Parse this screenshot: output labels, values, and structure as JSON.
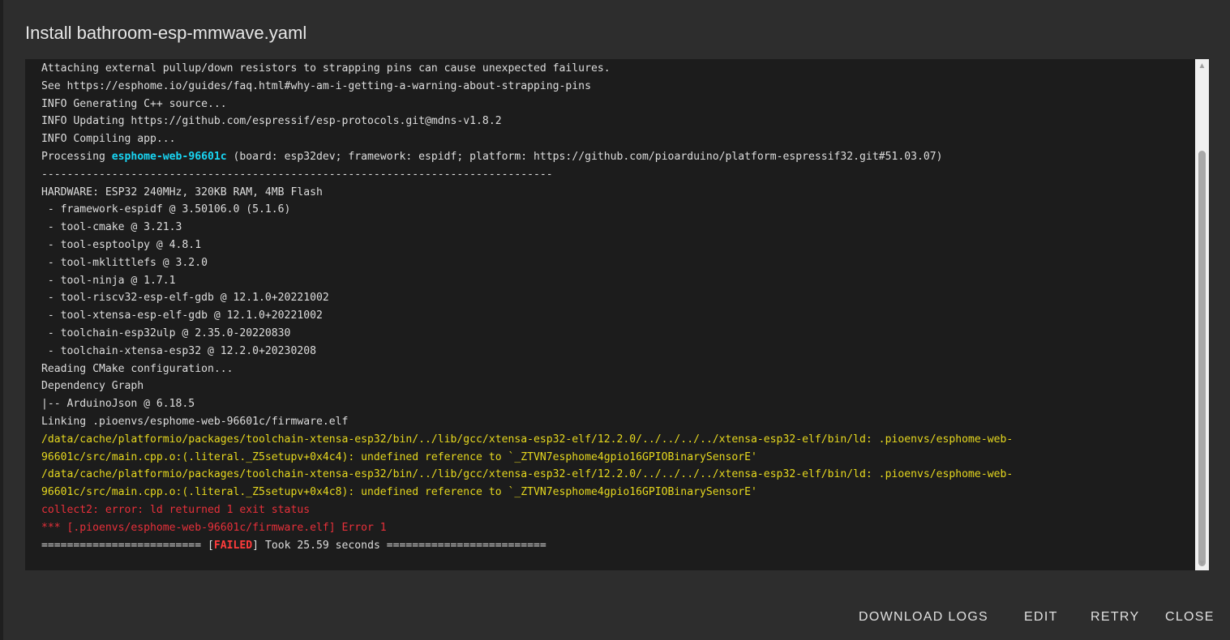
{
  "dialog": {
    "title": "Install bathroom-esp-mmwave.yaml"
  },
  "log": {
    "lines": [
      [
        {
          "t": "Attaching external pullup/down resistors to strapping pins can cause unexpected failures."
        }
      ],
      [
        {
          "t": "See https://esphome.io/guides/faq.html#why-am-i-getting-a-warning-about-strapping-pins"
        }
      ],
      [
        {
          "t": "INFO Generating C++ source..."
        }
      ],
      [
        {
          "t": "INFO Updating https://github.com/espressif/esp-protocols.git@mdns-v1.8.2"
        }
      ],
      [
        {
          "t": "INFO Compiling app..."
        }
      ],
      [
        {
          "t": "Processing "
        },
        {
          "t": "esphome-web-96601c",
          "c": "cyan"
        },
        {
          "t": " (board: esp32dev; framework: espidf; platform: https://github.com/pioarduino/platform-espressif32.git#51.03.07)"
        }
      ],
      [
        {
          "t": "--------------------------------------------------------------------------------"
        }
      ],
      [
        {
          "t": "HARDWARE: ESP32 240MHz, 320KB RAM, 4MB Flash"
        }
      ],
      [
        {
          "t": " - framework-espidf @ 3.50106.0 (5.1.6)"
        }
      ],
      [
        {
          "t": " - tool-cmake @ 3.21.3"
        }
      ],
      [
        {
          "t": " - tool-esptoolpy @ 4.8.1"
        }
      ],
      [
        {
          "t": " - tool-mklittlefs @ 3.2.0"
        }
      ],
      [
        {
          "t": " - tool-ninja @ 1.7.1"
        }
      ],
      [
        {
          "t": " - tool-riscv32-esp-elf-gdb @ 12.1.0+20221002"
        }
      ],
      [
        {
          "t": " - tool-xtensa-esp-elf-gdb @ 12.1.0+20221002"
        }
      ],
      [
        {
          "t": " - toolchain-esp32ulp @ 2.35.0-20220830"
        }
      ],
      [
        {
          "t": " - toolchain-xtensa-esp32 @ 12.2.0+20230208"
        }
      ],
      [
        {
          "t": "Reading CMake configuration..."
        }
      ],
      [
        {
          "t": "Dependency Graph"
        }
      ],
      [
        {
          "t": "|-- ArduinoJson @ 6.18.5"
        }
      ],
      [
        {
          "t": "Linking .pioenvs/esphome-web-96601c/firmware.elf"
        }
      ],
      [
        {
          "t": "/data/cache/platformio/packages/toolchain-xtensa-esp32/bin/../lib/gcc/xtensa-esp32-elf/12.2.0/../../../../xtensa-esp32-elf/bin/ld: .pioenvs/esphome-web-",
          "c": "yellow"
        }
      ],
      [
        {
          "t": "96601c/src/main.cpp.o:(.literal._Z5setupv+0x4c4): undefined reference to `_ZTVN7esphome4gpio16GPIOBinarySensorE'",
          "c": "yellow"
        }
      ],
      [
        {
          "t": "/data/cache/platformio/packages/toolchain-xtensa-esp32/bin/../lib/gcc/xtensa-esp32-elf/12.2.0/../../../../xtensa-esp32-elf/bin/ld: .pioenvs/esphome-web-",
          "c": "yellow"
        }
      ],
      [
        {
          "t": "96601c/src/main.cpp.o:(.literal._Z5setupv+0x4c8): undefined reference to `_ZTVN7esphome4gpio16GPIOBinarySensorE'",
          "c": "yellow"
        }
      ],
      [
        {
          "t": "collect2: error: ld returned 1 exit status",
          "c": "red"
        }
      ],
      [
        {
          "t": "*** [.pioenvs/esphome-web-96601c/firmware.elf] Error 1",
          "c": "red"
        }
      ],
      [
        {
          "t": "========================= ["
        },
        {
          "t": "FAILED",
          "c": "failed"
        },
        {
          "t": "] Took 25.59 seconds ========================="
        }
      ]
    ]
  },
  "scrollbar": {
    "up_icon": "triangle-up-icon",
    "down_icon": "triangle-down-icon",
    "position_fraction": 0.16,
    "visible_fraction": 0.86
  },
  "colors": {
    "warning": "#e6d81f",
    "error": "#e8303a",
    "highlight": "#18d5f3",
    "failed": "#ff3b3b"
  },
  "actions": {
    "download_logs": "DOWNLOAD LOGS",
    "edit": "EDIT",
    "retry": "RETRY",
    "close": "CLOSE"
  }
}
